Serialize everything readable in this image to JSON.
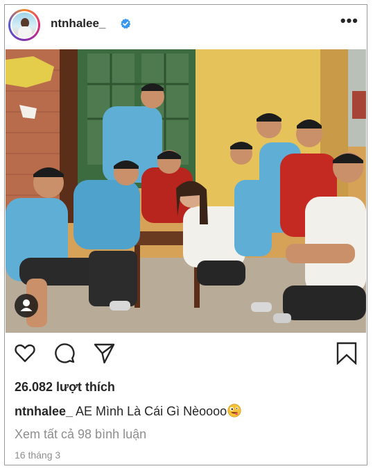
{
  "header": {
    "username": "ntnhalee_",
    "verified": true,
    "more_label": "•••"
  },
  "post": {
    "image_description_icon": "group-photo",
    "tag_icon": "person-icon"
  },
  "actions": {
    "icons": [
      "heart-icon",
      "comment-icon",
      "share-icon",
      "bookmark-icon"
    ]
  },
  "likes": "26.082 lượt thích",
  "caption": {
    "username": "ntnhalee_",
    "text": "AE Mình Là Cái Gì Nèoooo",
    "emoji_icon": "zany-face-emoji"
  },
  "comments_link": "Xem tất cả 98 bình luận",
  "date": "16 tháng 3",
  "colors": {
    "text": "#262626",
    "muted": "#8e8e8e",
    "verified": "#3897f0",
    "border": "#9a9a9a"
  }
}
